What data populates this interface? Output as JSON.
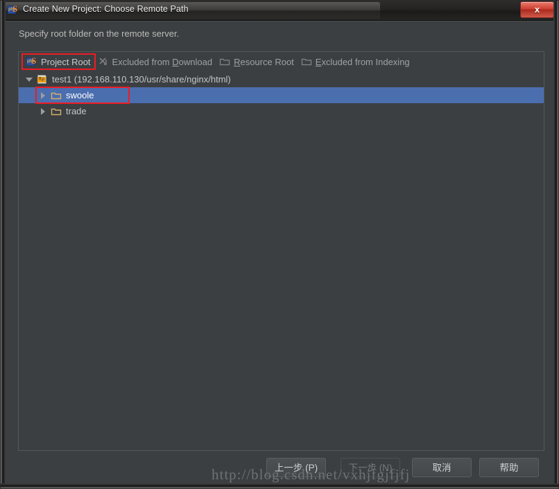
{
  "window": {
    "title": "Create New Project: Choose Remote Path",
    "app_icon": "phpstorm-icon",
    "close_label": "x"
  },
  "dialog": {
    "prompt": "Specify root folder on the remote server."
  },
  "legend": {
    "items": [
      {
        "label": "Project Root",
        "icon": "phpstorm-icon",
        "mnemonic": "",
        "highlighted": true
      },
      {
        "label": "Excluded from ",
        "mnemonic": "D",
        "label_tail": "ownload",
        "icon": "excluded-download-icon",
        "highlighted": false
      },
      {
        "label": "",
        "mnemonic": "R",
        "label_tail": "esource Root",
        "icon": "folder-outline-icon",
        "highlighted": false
      },
      {
        "label": "",
        "mnemonic": "E",
        "label_tail": "xcluded from Indexing",
        "icon": "folder-outline-icon",
        "highlighted": false
      }
    ]
  },
  "tree": {
    "rows": [
      {
        "label": "test1 (192.168.110.130/usr/share/nginx/html)",
        "icon": "ftp-server-icon",
        "twisty": "open",
        "indent": 0,
        "selected": false
      },
      {
        "label": "swoole",
        "icon": "folder-icon",
        "twisty": "closed",
        "indent": 1,
        "selected": true,
        "outlined": true
      },
      {
        "label": "trade",
        "icon": "folder-icon",
        "twisty": "closed",
        "indent": 1,
        "selected": false
      }
    ]
  },
  "buttons": {
    "previous": "上一步 (P)",
    "next": "下一步 (N)",
    "cancel": "取消",
    "help": "帮助"
  },
  "watermark": "http://blog.csdn.net/vxhjfgjfjfj",
  "colors": {
    "panel_bg": "#3c3f41",
    "selection_blue": "#4b6eaf",
    "highlight_red": "#ee1c25",
    "folder_tan": "#d6b070",
    "text": "#c4c6c8"
  }
}
